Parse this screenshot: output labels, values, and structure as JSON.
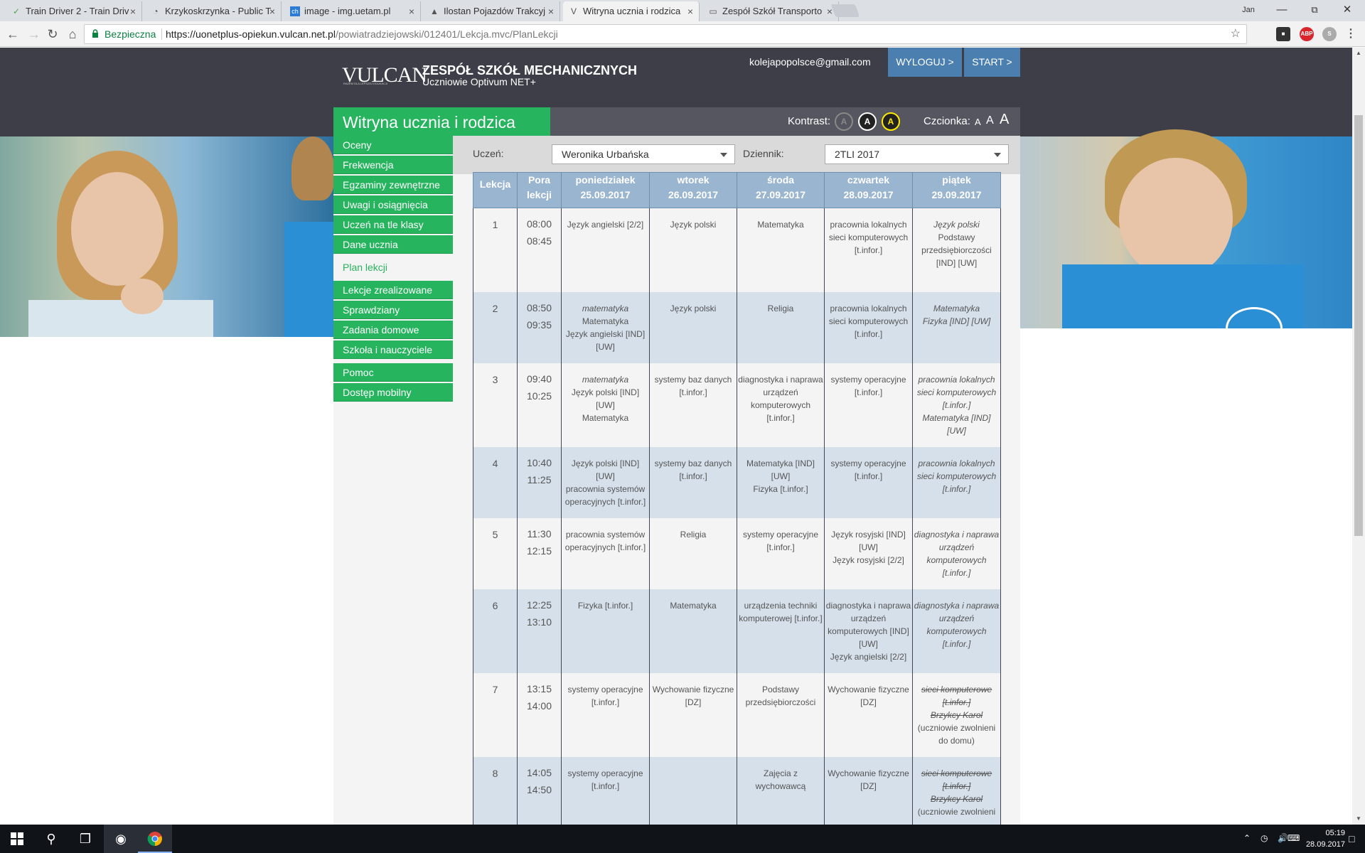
{
  "browser": {
    "tabs": [
      {
        "title": "Train Driver 2 - Train Driv",
        "icon": "checkmark-icon"
      },
      {
        "title": "Krzykoskrzynka - Public T",
        "icon": "circle-icon"
      },
      {
        "title": "image - img.uetam.pl",
        "icon": "ch-icon"
      },
      {
        "title": "Ilostan Pojazdów Trakcyj",
        "icon": "lock-icon"
      },
      {
        "title": "Witryna ucznia i rodzica",
        "icon": "vulcan-icon",
        "active": true
      },
      {
        "title": "Zespół Szkół Transporto",
        "icon": "document-icon"
      }
    ],
    "user_label": "Jan",
    "secure_label": "Bezpieczna",
    "url_base": "https://uonetplus-opiekun.vulcan.net.pl",
    "url_path": "/powiatradziejowski/012401/Lekcja.mvc/PlanLekcji",
    "ext_abp": "ABP"
  },
  "header": {
    "logo": "VULCAN",
    "logo_tagline": "RAZEM DLA LEPSZEJ EDUKACJI",
    "school_name": "ZESPÓŁ SZKÓŁ MECHANICZNYCH",
    "school_sub": "Uczniowie Optivum NET+",
    "email": "kolejapopolsce@gmail.com",
    "logout_label": "WYLOGUJ >",
    "start_label": "START >"
  },
  "panel": {
    "title": "Witryna ucznia i rodzica",
    "contrast_label": "Kontrast:",
    "contrast_options": [
      "A",
      "A",
      "A"
    ],
    "font_label": "Czcionka:",
    "font_options": [
      "A",
      "A",
      "A"
    ]
  },
  "menu": [
    {
      "label": "Oceny"
    },
    {
      "label": "Frekwencja"
    },
    {
      "label": "Egzaminy zewnętrzne"
    },
    {
      "label": "Uwagi i osiągnięcia"
    },
    {
      "label": "Uczeń na tle klasy"
    },
    {
      "label": "Dane ucznia"
    },
    {
      "label": "Plan lekcji",
      "selected": true
    },
    {
      "label": "Lekcje zrealizowane"
    },
    {
      "label": "Sprawdziany"
    },
    {
      "label": "Zadania domowe"
    },
    {
      "label": "Szkoła i nauczyciele"
    },
    {
      "label": "Pomoc"
    },
    {
      "label": "Dostęp mobilny"
    }
  ],
  "filters": {
    "student_label": "Uczeń:",
    "student_value": "Weronika Urbańska",
    "journal_label": "Dziennik:",
    "journal_value": "2TLI 2017"
  },
  "timetable": {
    "col_lesson": "Lekcja",
    "col_time_1": "Pora",
    "col_time_2": "lekcji",
    "days": [
      {
        "name": "poniedziałek",
        "date": "25.09.2017"
      },
      {
        "name": "wtorek",
        "date": "26.09.2017"
      },
      {
        "name": "środa",
        "date": "27.09.2017"
      },
      {
        "name": "czwartek",
        "date": "28.09.2017"
      },
      {
        "name": "piątek",
        "date": "29.09.2017"
      }
    ],
    "rows": [
      {
        "num": "1",
        "start": "08:00",
        "end": "08:45",
        "cells": [
          [
            {
              "t": "Język angielski [2/2]"
            }
          ],
          [
            {
              "t": "Język polski"
            }
          ],
          [
            {
              "t": "Matematyka"
            }
          ],
          [
            {
              "t": "pracownia lokalnych sieci komputerowych [t.infor.]"
            }
          ],
          [
            {
              "t": "Język polski",
              "s": "it"
            },
            {
              "t": "Podstawy przedsiębiorczości [IND] [UW]"
            }
          ]
        ]
      },
      {
        "num": "2",
        "start": "08:50",
        "end": "09:35",
        "cells": [
          [
            {
              "t": "matematyka",
              "s": "it"
            },
            {
              "t": "Matematyka"
            },
            {
              "t": "Język angielski [IND] [UW]"
            }
          ],
          [
            {
              "t": "Język polski"
            }
          ],
          [
            {
              "t": "Religia"
            }
          ],
          [
            {
              "t": "pracownia lokalnych sieci komputerowych [t.infor.]"
            }
          ],
          [
            {
              "t": "Matematyka",
              "s": "it"
            },
            {
              "t": "Fizyka [IND] [UW]",
              "s": "it"
            }
          ]
        ]
      },
      {
        "num": "3",
        "start": "09:40",
        "end": "10:25",
        "cells": [
          [
            {
              "t": "matematyka",
              "s": "it"
            },
            {
              "t": "Język polski [IND] [UW]"
            },
            {
              "t": "Matematyka"
            }
          ],
          [
            {
              "t": "systemy baz danych [t.infor.]"
            }
          ],
          [
            {
              "t": "diagnostyka i naprawa urządzeń komputerowych [t.infor.]"
            }
          ],
          [
            {
              "t": "systemy operacyjne [t.infor.]"
            }
          ],
          [
            {
              "t": "pracownia lokalnych sieci komputerowych [t.infor.]",
              "s": "it"
            },
            {
              "t": "Matematyka [IND] [UW]",
              "s": "it"
            }
          ]
        ]
      },
      {
        "num": "4",
        "start": "10:40",
        "end": "11:25",
        "cells": [
          [
            {
              "t": "Język polski [IND] [UW]"
            },
            {
              "t": "pracownia systemów operacyjnych [t.infor.]"
            }
          ],
          [
            {
              "t": "systemy baz danych [t.infor.]"
            }
          ],
          [
            {
              "t": "Matematyka [IND] [UW]"
            },
            {
              "t": "Fizyka [t.infor.]"
            }
          ],
          [
            {
              "t": "systemy operacyjne [t.infor.]"
            }
          ],
          [
            {
              "t": "pracownia lokalnych sieci komputerowych [t.infor.]",
              "s": "it"
            }
          ]
        ]
      },
      {
        "num": "5",
        "start": "11:30",
        "end": "12:15",
        "cells": [
          [
            {
              "t": "pracownia systemów operacyjnych [t.infor.]"
            }
          ],
          [
            {
              "t": "Religia"
            }
          ],
          [
            {
              "t": "systemy operacyjne [t.infor.]"
            }
          ],
          [
            {
              "t": "Język rosyjski [IND] [UW]"
            },
            {
              "t": "Język rosyjski [2/2]"
            }
          ],
          [
            {
              "t": "diagnostyka i naprawa urządzeń komputerowych [t.infor.]",
              "s": "it"
            }
          ]
        ]
      },
      {
        "num": "6",
        "start": "12:25",
        "end": "13:10",
        "cells": [
          [
            {
              "t": "Fizyka [t.infor.]"
            }
          ],
          [
            {
              "t": "Matematyka"
            }
          ],
          [
            {
              "t": "urządzenia techniki komputerowej [t.infor.]"
            }
          ],
          [
            {
              "t": "diagnostyka i naprawa urządzeń komputerowych [IND] [UW]"
            },
            {
              "t": "Język angielski [2/2]"
            }
          ],
          [
            {
              "t": "diagnostyka i naprawa urządzeń komputerowych [t.infor.]",
              "s": "it"
            }
          ]
        ]
      },
      {
        "num": "7",
        "start": "13:15",
        "end": "14:00",
        "cells": [
          [
            {
              "t": "systemy operacyjne [t.infor.]"
            }
          ],
          [
            {
              "t": "Wychowanie fizyczne [DZ]"
            }
          ],
          [
            {
              "t": "Podstawy przedsiębiorczości"
            }
          ],
          [
            {
              "t": "Wychowanie fizyczne [DZ]"
            }
          ],
          [
            {
              "t": "sieci komputerowe [t.infor.]",
              "s": "st"
            },
            {
              "t": "Brzykcy Karol",
              "s": "st"
            },
            {
              "t": "(uczniowie zwolnieni do domu)"
            }
          ]
        ]
      },
      {
        "num": "8",
        "start": "14:05",
        "end": "14:50",
        "cells": [
          [
            {
              "t": "systemy operacyjne [t.infor.]"
            }
          ],
          [
            {
              "t": ""
            }
          ],
          [
            {
              "t": "Zajęcia z wychowawcą"
            }
          ],
          [
            {
              "t": "Wychowanie fizyczne [DZ]"
            }
          ],
          [
            {
              "t": "sieci komputerowe [t.infor.]",
              "s": "st"
            },
            {
              "t": "Brzykcy Karol",
              "s": "st"
            },
            {
              "t": "(uczniowie zwolnieni"
            }
          ]
        ]
      }
    ]
  },
  "taskbar": {
    "time": "05:19",
    "date": "28.09.2017"
  },
  "colors": {
    "accent_green": "#27b45e",
    "header_dark": "#3d3e47",
    "button_blue": "#4a7faf",
    "table_header": "#9ab5cf",
    "row_alt": "#d5e0ea"
  }
}
